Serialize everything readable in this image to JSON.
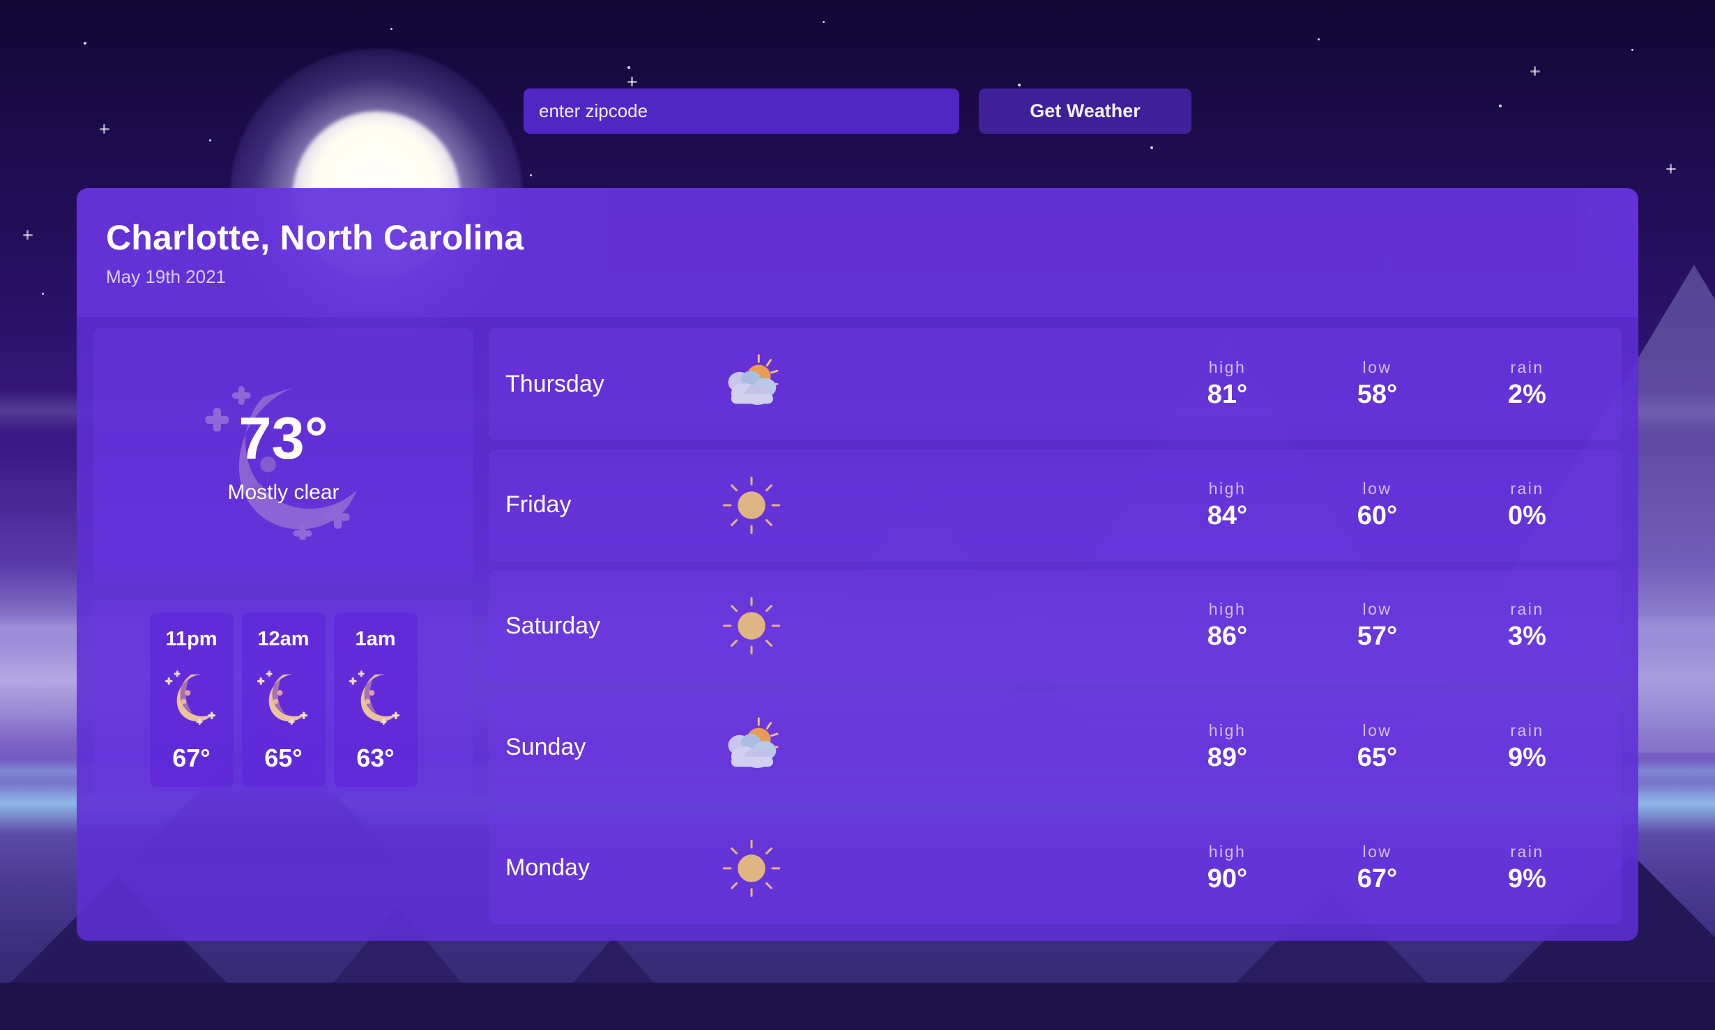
{
  "search": {
    "input_placeholder": "enter zipcode",
    "input_value": "",
    "button_label": "Get Weather"
  },
  "header": {
    "city": "Charlotte, North Carolina",
    "date": "May 19th 2021"
  },
  "current": {
    "temp": "73°",
    "condition": "Mostly clear",
    "icon": "crescent-moon"
  },
  "hourly": [
    {
      "time": "11pm",
      "temp": "67°",
      "icon": "crescent-moon"
    },
    {
      "time": "12am",
      "temp": "65°",
      "icon": "crescent-moon"
    },
    {
      "time": "1am",
      "temp": "63°",
      "icon": "crescent-moon"
    }
  ],
  "forecast": {
    "labels": {
      "high": "high",
      "low": "low",
      "rain": "rain"
    },
    "days": [
      {
        "day": "Thursday",
        "icon": "partly-cloudy",
        "high": "81°",
        "low": "58°",
        "rain": "2%"
      },
      {
        "day": "Friday",
        "icon": "sun",
        "high": "84°",
        "low": "60°",
        "rain": "0%"
      },
      {
        "day": "Saturday",
        "icon": "sun",
        "high": "86°",
        "low": "57°",
        "rain": "3%"
      },
      {
        "day": "Sunday",
        "icon": "partly-cloudy",
        "high": "89°",
        "low": "65°",
        "rain": "9%"
      },
      {
        "day": "Monday",
        "icon": "sun",
        "high": "90°",
        "low": "67°",
        "rain": "9%"
      }
    ]
  },
  "colors": {
    "card": "#602DD6",
    "row": "#6E3AE4",
    "input": "#5027C4",
    "button": "#3F2099",
    "sun": "#E0B584",
    "moon": "#E8C39E",
    "cloud": "#CFCDEE",
    "sky_night": "#120733"
  }
}
